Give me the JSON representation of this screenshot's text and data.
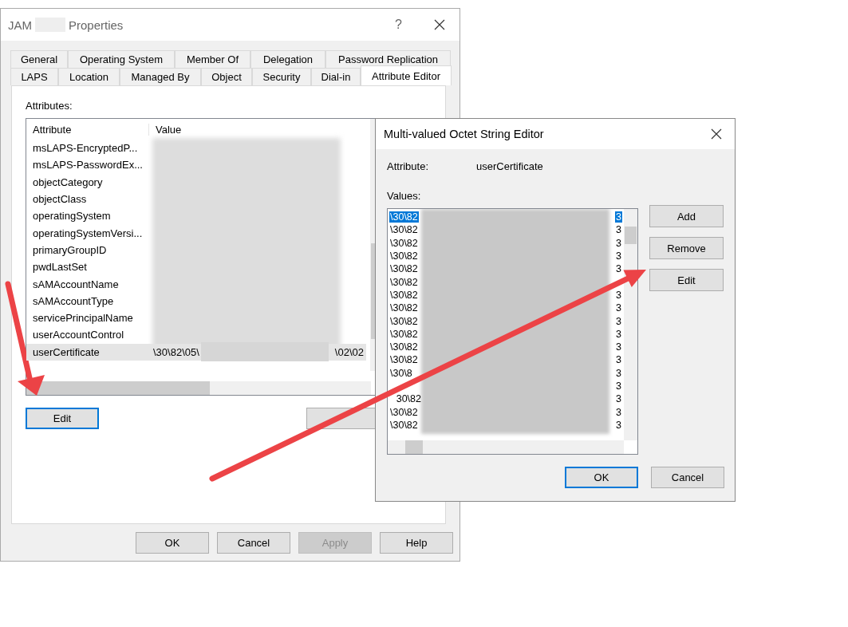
{
  "properties_window": {
    "title_start": "JAM",
    "title_end": "Properties",
    "help_glyph": "?",
    "tabs_back": [
      {
        "label": "General",
        "selected": false
      },
      {
        "label": "Operating System",
        "selected": false
      },
      {
        "label": "Member Of",
        "selected": false
      },
      {
        "label": "Delegation",
        "selected": false
      },
      {
        "label": "Password Replication",
        "selected": false
      }
    ],
    "tabs_front": [
      {
        "label": "LAPS",
        "selected": false
      },
      {
        "label": "Location",
        "selected": false
      },
      {
        "label": "Managed By",
        "selected": false
      },
      {
        "label": "Object",
        "selected": false
      },
      {
        "label": "Security",
        "selected": false
      },
      {
        "label": "Dial-in",
        "selected": false
      },
      {
        "label": "Attribute Editor",
        "selected": true
      }
    ],
    "attributes_label": "Attributes:",
    "columns": [
      "Attribute",
      "Value"
    ],
    "rows": [
      {
        "attribute": "msLAPS-EncryptedP...",
        "selected": false
      },
      {
        "attribute": "msLAPS-PasswordEx...",
        "selected": false
      },
      {
        "attribute": "objectCategory",
        "selected": false
      },
      {
        "attribute": "objectClass",
        "selected": false
      },
      {
        "attribute": "operatingSystem",
        "selected": false
      },
      {
        "attribute": "operatingSystemVersi...",
        "selected": false
      },
      {
        "attribute": "primaryGroupID",
        "selected": false
      },
      {
        "attribute": "pwdLastSet",
        "selected": false
      },
      {
        "attribute": "sAMAccountName",
        "selected": false
      },
      {
        "attribute": "sAMAccountType",
        "selected": false
      },
      {
        "attribute": "servicePrincipalName",
        "selected": false
      },
      {
        "attribute": "userAccountControl",
        "selected": false
      },
      {
        "attribute": "userCertificate",
        "value_start": "\\30\\82\\05\\",
        "value_end": "\\02\\02",
        "selected": true
      }
    ],
    "edit_button": "Edit",
    "buttons": [
      {
        "label": "OK",
        "disabled": false
      },
      {
        "label": "Cancel",
        "disabled": false
      },
      {
        "label": "Apply",
        "disabled": true
      },
      {
        "label": "Help",
        "disabled": false
      }
    ]
  },
  "editor_dialog": {
    "title": "Multi-valued Octet String Editor",
    "attribute_label": "Attribute:",
    "attribute_value": "userCertificate",
    "values_label": "Values:",
    "values": [
      {
        "kind": "full",
        "start": "\\30\\82",
        "end": "3",
        "selected": true
      },
      {
        "kind": "full",
        "start": "\\30\\82",
        "end": "3",
        "selected": false
      },
      {
        "kind": "full",
        "start": "\\30\\82",
        "end": "3",
        "selected": false
      },
      {
        "kind": "full",
        "start": "\\30\\82",
        "end": "3",
        "selected": false
      },
      {
        "kind": "full",
        "start": "\\30\\82",
        "end": "3",
        "selected": false
      },
      {
        "kind": "full",
        "start": "\\30\\82",
        "selected": false
      },
      {
        "kind": "full",
        "start": "\\30\\82",
        "end": "3",
        "selected": false
      },
      {
        "kind": "full",
        "start": "\\30\\82",
        "end": "3",
        "selected": false
      },
      {
        "kind": "full",
        "start": "\\30\\82",
        "end": "3",
        "selected": false
      },
      {
        "kind": "full",
        "start": "\\30\\82",
        "end": "3",
        "selected": false
      },
      {
        "kind": "full",
        "start": "\\30\\82",
        "end": "3",
        "selected": false
      },
      {
        "kind": "full",
        "start": "\\30\\82",
        "end": "3",
        "selected": false
      },
      {
        "kind": "head",
        "start": "\\30\\8",
        "end": "3",
        "selected": false
      },
      {
        "kind": "full",
        "end": "3",
        "selected": false
      },
      {
        "kind": "tail",
        "start": "30\\82",
        "end": "3",
        "selected": false
      },
      {
        "kind": "full",
        "start": "\\30\\82",
        "end": "3",
        "selected": false
      },
      {
        "kind": "full",
        "start": "\\30\\82",
        "end": "3",
        "selected": false
      }
    ],
    "side_buttons": [
      "Add",
      "Remove",
      "Edit"
    ],
    "buttons": [
      {
        "label": "OK",
        "default": true
      },
      {
        "label": "Cancel",
        "default": false
      }
    ]
  }
}
